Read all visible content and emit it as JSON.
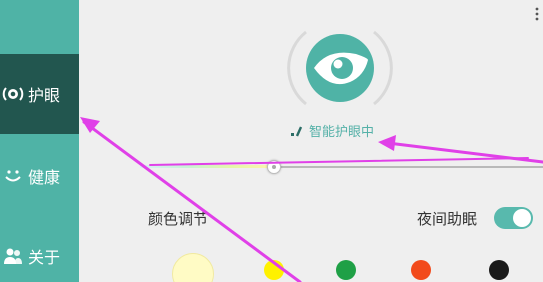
{
  "sidebar": {
    "items": [
      {
        "label": "护眼",
        "icon": "eye-ring-icon",
        "active": true
      },
      {
        "label": "健康",
        "icon": "smile-icon",
        "active": false
      },
      {
        "label": "关于",
        "icon": "people-icon",
        "active": false
      }
    ]
  },
  "main": {
    "mode_label": "智能护眼中",
    "color_adjust_label": "颜色调节",
    "night_mode_label": "夜间助眠",
    "night_mode_on": true,
    "slider_value_percent": 33,
    "swatches": [
      {
        "name": "cream",
        "color": "#fffbc5"
      },
      {
        "name": "yellow",
        "color": "#fff100"
      },
      {
        "name": "green",
        "color": "#1fa046"
      },
      {
        "name": "orange",
        "color": "#f24a1b"
      },
      {
        "name": "black",
        "color": "#1a1a1a"
      }
    ]
  },
  "colors": {
    "accent": "#4fb3a6",
    "sidebar_active": "#22564f",
    "annotation_arrow": "#e040e8"
  }
}
